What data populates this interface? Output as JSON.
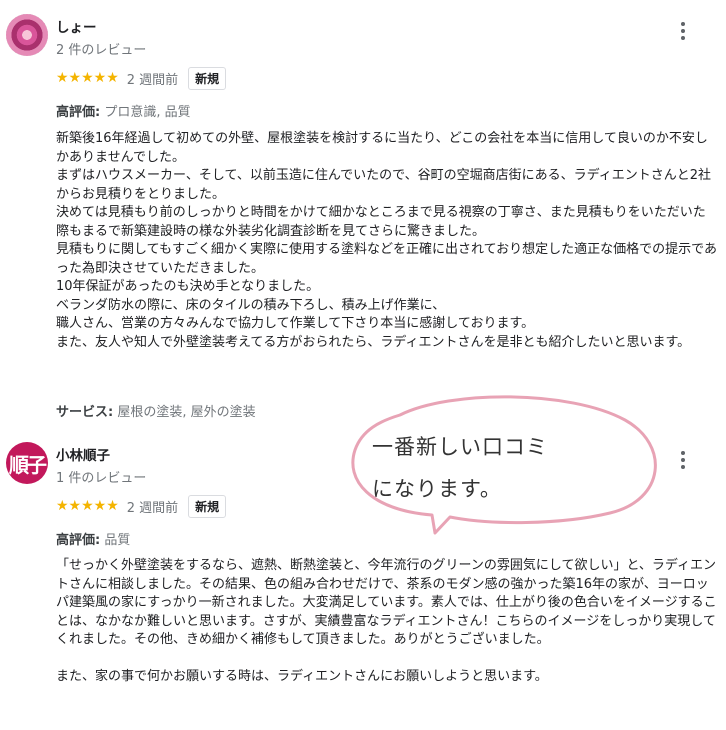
{
  "reviews": [
    {
      "name": "しょー",
      "review_count": "2 件のレビュー",
      "stars": "★★★★★",
      "time": "2 週間前",
      "badge": "新規",
      "highlights_label": "高評価:",
      "highlights_value": " プロ意識, 品質",
      "text": "新築後16年経過して初めての外壁、屋根塗装を検討するに当たり、どこの会社を本当に信用して良いのか不安しかありませんでした。\nまずはハウスメーカー、そして、以前玉造に住んでいたので、谷町の空堀商店街にある、ラディエントさんと2社からお見積りをとりました。\n決めては見積もり前のしっかりと時間をかけて細かなところまで見る視察の丁寧さ、また見積もりをいただいた際もまるで新築建設時の様な外装劣化調査診断を見てさらに驚きました。\n見積もりに関してもすごく細かく実際に使用する塗料などを正確に出されており想定した適正な価格での提示であった為即決させていただきました。\n10年保証があったのも決め手となりました。\nベランダ防水の際に、床のタイルの積み下ろし、積み上げ作業に、\n職人さん、営業の方々みんなで協力して作業して下さり本当に感謝しております。\nまた、友人や知人で外壁塗装考えてる方がおられたら、ラディエントさんを是非とも紹介したいと思います。",
      "services_label": "サービス:",
      "services_value": " 屋根の塗装, 屋外の塗装"
    },
    {
      "name": "小林順子",
      "avatar_initial": "順子",
      "review_count": "1 件のレビュー",
      "stars": "★★★★★",
      "time": "2 週間前",
      "badge": "新規",
      "highlights_label": "高評価:",
      "highlights_value": " 品質",
      "text": "「せっかく外壁塗装をするなら、遮熱、断熱塗装と、今年流行のグリーンの雰囲気にして欲しい」と、ラディエントさんに相談しました。その結果、色の組み合わせだけで、茶系のモダン感の強かった築16年の家が、ヨーロッパ建築風の家にすっかり一新されました。大変満足しています。素人では、仕上がり後の色合いをイメージすることは、なかなか難しいと思います。さすが、実績豊富なラディエントさん！こちらのイメージをしっかり実現してくれました。その他、きめ細かく補修もして頂きました。ありがとうございました。\n\nまた、家の事で何かお願いする時は、ラディエントさんにお願いしようと思います。"
    }
  ],
  "callout": {
    "line1": "一番新しい口コミ",
    "line2": "になります。",
    "stroke_color": "#e8a3b5"
  },
  "icons": {
    "more": "more-vert-icon",
    "star": "star-icon"
  }
}
